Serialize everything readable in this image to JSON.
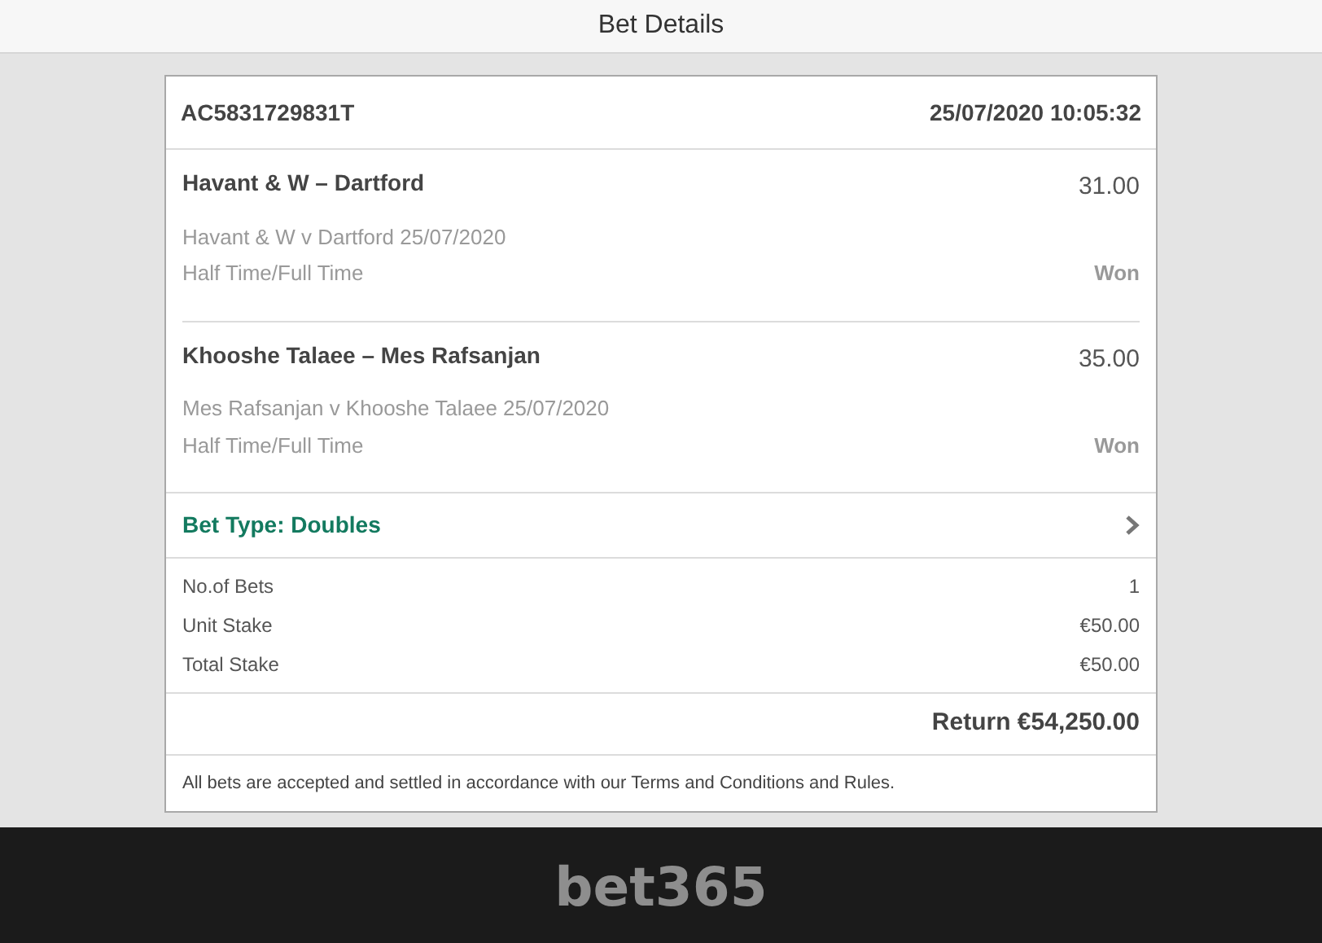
{
  "header": {
    "title": "Bet Details"
  },
  "bet": {
    "reference": "AC5831729831T",
    "placed": "25/07/2020 10:05:32",
    "selections": [
      {
        "name": "Havant & W – Dartford",
        "odds": "31.00",
        "event": "Havant & W v Dartford 25/07/2020",
        "market": "Half Time/Full Time",
        "result": "Won"
      },
      {
        "name": "Khooshe Talaee – Mes Rafsanjan",
        "odds": "35.00",
        "event": "Mes Rafsanjan v Khooshe Talaee 25/07/2020",
        "market": "Half Time/Full Time",
        "result": "Won"
      }
    ],
    "bet_type": "Bet Type: Doubles",
    "stakes": [
      {
        "label": "No.of Bets",
        "value": "1"
      },
      {
        "label": "Unit Stake",
        "value": "€50.00"
      },
      {
        "label": "Total Stake",
        "value": "€50.00"
      }
    ],
    "return": "Return €54,250.00",
    "terms": "All bets are accepted and settled in accordance with our Terms and Conditions and Rules."
  },
  "footer": {
    "logo": "bet365"
  }
}
